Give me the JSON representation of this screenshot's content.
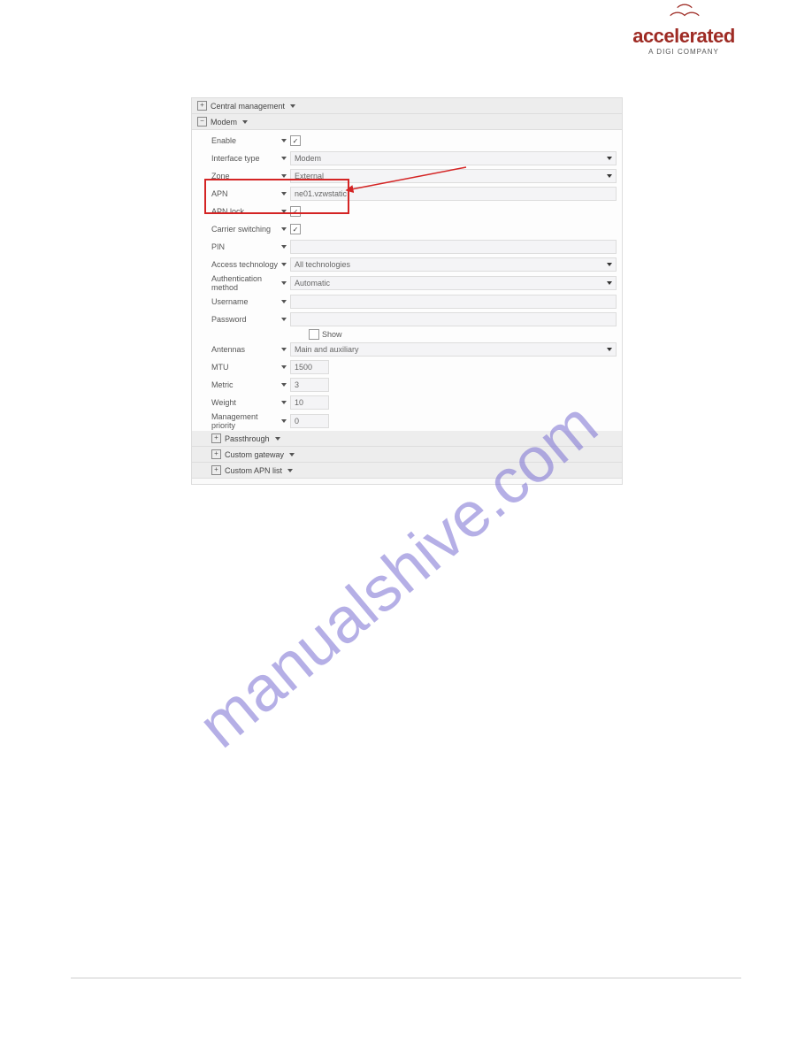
{
  "logo": {
    "text": "accelerated",
    "sub": "A DIGI COMPANY"
  },
  "sections": {
    "central": "Central management",
    "modem": "Modem",
    "passthrough": "Passthrough",
    "custom_gateway": "Custom gateway",
    "custom_apn": "Custom APN list"
  },
  "form": {
    "enable": {
      "label": "Enable",
      "checked": true
    },
    "interface_type": {
      "label": "Interface type",
      "value": "Modem"
    },
    "zone": {
      "label": "Zone",
      "value": "External"
    },
    "apn": {
      "label": "APN",
      "value": "ne01.vzwstatic"
    },
    "apn_lock": {
      "label": "APN lock",
      "checked": true
    },
    "carrier_switching": {
      "label": "Carrier switching",
      "checked": true
    },
    "pin": {
      "label": "PIN",
      "value": ""
    },
    "access_tech": {
      "label": "Access technology",
      "value": "All technologies"
    },
    "auth_method": {
      "label": "Authentication method",
      "value": "Automatic"
    },
    "username": {
      "label": "Username",
      "value": ""
    },
    "password": {
      "label": "Password",
      "value": ""
    },
    "show": "Show",
    "antennas": {
      "label": "Antennas",
      "value": "Main and auxiliary"
    },
    "mtu": {
      "label": "MTU",
      "value": "1500"
    },
    "metric": {
      "label": "Metric",
      "value": "3"
    },
    "weight": {
      "label": "Weight",
      "value": "10"
    },
    "mgmt_priority": {
      "label": "Management priority",
      "value": "0"
    }
  },
  "watermark": "manualshive.com"
}
